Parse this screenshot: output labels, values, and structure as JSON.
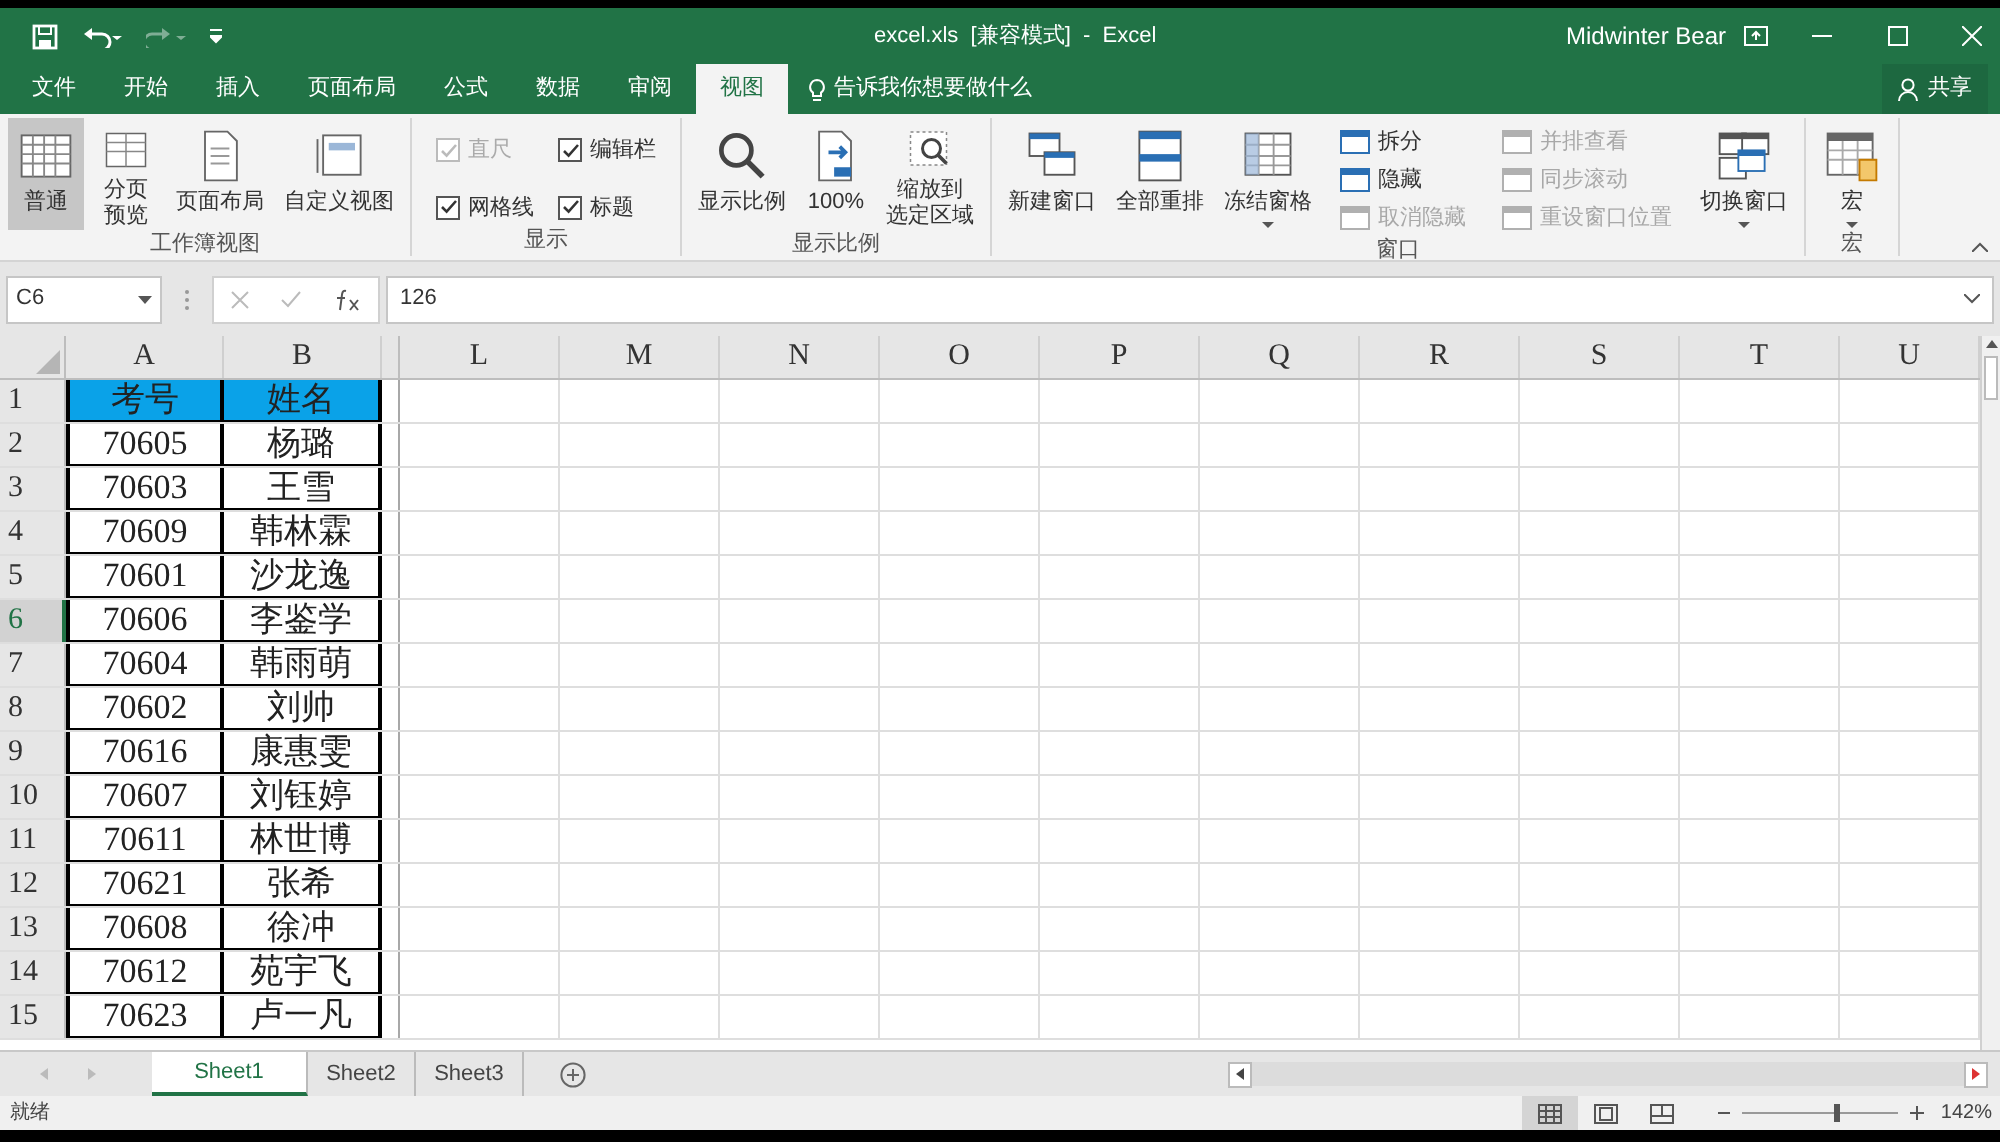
{
  "title_bar": {
    "title": "excel.xls  [兼容模式]  -  Excel",
    "user": "Midwinter Bear"
  },
  "menu_tabs": [
    {
      "label": "文件",
      "selected": false
    },
    {
      "label": "开始",
      "selected": false
    },
    {
      "label": "插入",
      "selected": false
    },
    {
      "label": "页面布局",
      "selected": false
    },
    {
      "label": "公式",
      "selected": false
    },
    {
      "label": "数据",
      "selected": false
    },
    {
      "label": "审阅",
      "selected": false
    },
    {
      "label": "视图",
      "selected": true
    }
  ],
  "tell_me": "告诉我你想要做什么",
  "share": "共享",
  "ribbon_groups": [
    {
      "name": "工作簿视图",
      "items": [
        {
          "kind": "large",
          "label": "普通",
          "selected": true
        },
        {
          "kind": "large",
          "lines": [
            "分页",
            "预览"
          ],
          "selected": false
        },
        {
          "kind": "large",
          "label": "页面布局",
          "selected": false
        },
        {
          "kind": "large",
          "label": "自定义视图",
          "selected": false
        }
      ]
    },
    {
      "name": "显示",
      "items": [
        {
          "kind": "check",
          "label": "直尺",
          "checked": true,
          "disabled": true
        },
        {
          "kind": "check",
          "label": "编辑栏",
          "checked": true,
          "disabled": false
        },
        {
          "kind": "check",
          "label": "网格线",
          "checked": true,
          "disabled": false
        },
        {
          "kind": "check",
          "label": "标题",
          "checked": true,
          "disabled": false
        }
      ]
    },
    {
      "name": "显示比例",
      "items": [
        {
          "kind": "large",
          "label": "显示比例"
        },
        {
          "kind": "large",
          "label": "100%"
        },
        {
          "kind": "large",
          "lines": [
            "缩放到",
            "选定区域"
          ]
        }
      ]
    },
    {
      "name": "窗口",
      "items": [
        {
          "kind": "large",
          "label": "新建窗口"
        },
        {
          "kind": "large",
          "label": "全部重排"
        },
        {
          "kind": "large",
          "label": "冻结窗格",
          "dropdown": true
        },
        {
          "kind": "small",
          "label": "拆分",
          "disabled": false
        },
        {
          "kind": "small",
          "label": "隐藏",
          "disabled": false
        },
        {
          "kind": "small",
          "label": "取消隐藏",
          "disabled": true
        },
        {
          "kind": "small",
          "label": "并排查看",
          "disabled": true
        },
        {
          "kind": "small",
          "label": "同步滚动",
          "disabled": true
        },
        {
          "kind": "small",
          "label": "重设窗口位置",
          "disabled": true
        },
        {
          "kind": "large",
          "label": "切换窗口",
          "dropdown": true
        }
      ]
    },
    {
      "name": "宏",
      "items": [
        {
          "kind": "large",
          "label": "宏",
          "dropdown": true
        }
      ]
    }
  ],
  "name_box": "C6",
  "formula": "126",
  "columns": [
    "A",
    "B",
    "L",
    "M",
    "N",
    "O",
    "P",
    "Q",
    "R",
    "S",
    "T",
    "U"
  ],
  "rows": [
    {
      "num": "1",
      "kind": "header",
      "selected": false,
      "cells": [
        "考号",
        "姓名"
      ]
    },
    {
      "num": "2",
      "kind": "data",
      "selected": false,
      "cells": [
        "70605",
        "杨璐"
      ]
    },
    {
      "num": "3",
      "kind": "data",
      "selected": false,
      "cells": [
        "70603",
        "王雪"
      ]
    },
    {
      "num": "4",
      "kind": "data",
      "selected": false,
      "cells": [
        "70609",
        "韩林霖"
      ]
    },
    {
      "num": "5",
      "kind": "data",
      "selected": false,
      "cells": [
        "70601",
        "沙龙逸"
      ]
    },
    {
      "num": "6",
      "kind": "data",
      "selected": true,
      "cells": [
        "70606",
        "李鉴学"
      ]
    },
    {
      "num": "7",
      "kind": "data",
      "selected": false,
      "cells": [
        "70604",
        "韩雨萌"
      ]
    },
    {
      "num": "8",
      "kind": "data",
      "selected": false,
      "cells": [
        "70602",
        "刘帅"
      ]
    },
    {
      "num": "9",
      "kind": "data",
      "selected": false,
      "cells": [
        "70616",
        "康惠雯"
      ]
    },
    {
      "num": "10",
      "kind": "data",
      "selected": false,
      "cells": [
        "70607",
        "刘钰婷"
      ]
    },
    {
      "num": "11",
      "kind": "data",
      "selected": false,
      "cells": [
        "70611",
        "林世博"
      ]
    },
    {
      "num": "12",
      "kind": "data",
      "selected": false,
      "cells": [
        "70621",
        "张希"
      ]
    },
    {
      "num": "13",
      "kind": "data",
      "selected": false,
      "cells": [
        "70608",
        "徐冲"
      ]
    },
    {
      "num": "14",
      "kind": "data",
      "selected": false,
      "cells": [
        "70612",
        "苑宇飞"
      ]
    },
    {
      "num": "15",
      "kind": "data",
      "selected": false,
      "cells": [
        "70623",
        "卢一凡"
      ]
    }
  ],
  "sheets": [
    {
      "label": "Sheet1",
      "selected": true
    },
    {
      "label": "Sheet2",
      "selected": false
    },
    {
      "label": "Sheet3",
      "selected": false
    }
  ],
  "status": "就绪",
  "views": [
    {
      "selected": true
    },
    {
      "selected": false
    },
    {
      "selected": false
    }
  ],
  "zoom": {
    "level": 0.58,
    "reading": "142%"
  }
}
